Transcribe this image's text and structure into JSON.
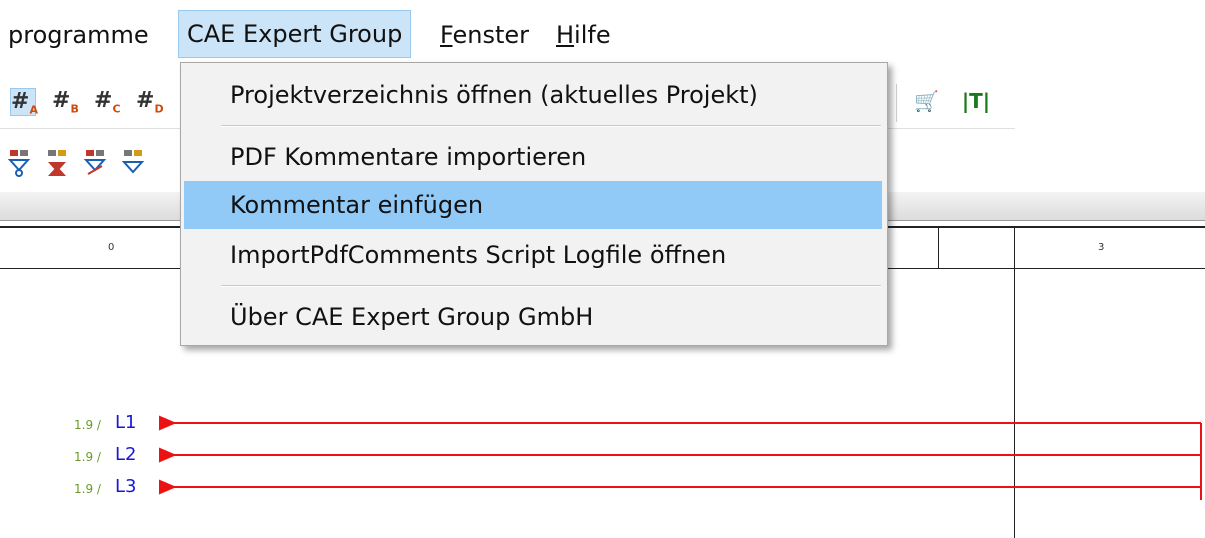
{
  "menubar": {
    "items": [
      {
        "label": "programme"
      },
      {
        "label": "CAE Expert Group"
      },
      {
        "label_prefix": "",
        "mnemonic": "F",
        "label_rest": "enster"
      },
      {
        "label_prefix": "",
        "mnemonic": "H",
        "label_rest": "ilfe"
      }
    ]
  },
  "toolbar1": {
    "icons": [
      {
        "name": "grid-a-icon",
        "glyph": "#",
        "sub": "A",
        "color": "#d24a0a"
      },
      {
        "name": "grid-b-icon",
        "glyph": "#",
        "sub": "B",
        "color": "#d24a0a"
      },
      {
        "name": "grid-c-icon",
        "glyph": "#",
        "sub": "C",
        "color": "#d24a0a"
      },
      {
        "name": "grid-d-icon",
        "glyph": "#",
        "sub": "D",
        "color": "#d24a0a"
      }
    ],
    "right_icons": [
      {
        "name": "cart-icon",
        "glyph": "🛒"
      },
      {
        "name": "text-insert-icon",
        "glyph": "|T|"
      }
    ]
  },
  "dropdown": {
    "items": [
      {
        "label": "Projektverzeichnis öffnen (aktuelles Projekt)"
      },
      {
        "label": "PDF Kommentare importieren"
      },
      {
        "label": "Kommentar einfügen"
      },
      {
        "label": "ImportPdfComments Script Logfile öffnen"
      },
      {
        "label": "Über CAE Expert Group GmbH"
      }
    ],
    "highlighted_index": 2
  },
  "sheet": {
    "columns": [
      "0",
      "3"
    ],
    "wires": [
      {
        "ref": "1.9 /",
        "name": "L1"
      },
      {
        "ref": "1.9 /",
        "name": "L2"
      },
      {
        "ref": "1.9 /",
        "name": "L3"
      }
    ],
    "wire_color": "#ee1111"
  }
}
